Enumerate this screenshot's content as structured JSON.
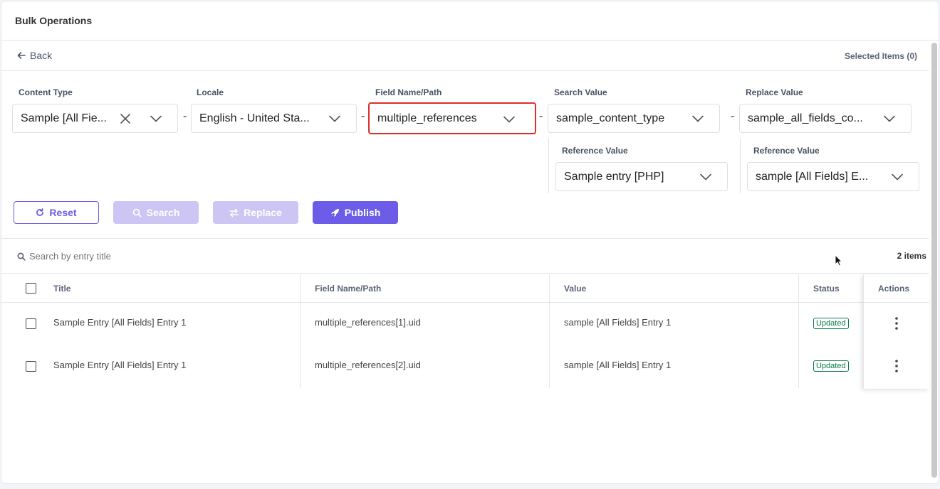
{
  "app": {
    "title": "Bulk Operations"
  },
  "nav": {
    "back_label": "Back",
    "selected_items": "Selected Items (0)"
  },
  "filters": {
    "content_type": {
      "label": "Content Type",
      "value": "Sample [All Fie..."
    },
    "locale": {
      "label": "Locale",
      "value": "English - United Sta..."
    },
    "field_name": {
      "label": "Field Name/Path",
      "value": "multiple_references"
    },
    "search_value": {
      "label": "Search Value",
      "value": "sample_content_type"
    },
    "replace_value": {
      "label": "Replace Value",
      "value": "sample_all_fields_co..."
    },
    "search_reference": {
      "label": "Reference Value",
      "value": "Sample entry [PHP]"
    },
    "replace_reference": {
      "label": "Reference Value",
      "value": "sample [All Fields] E..."
    },
    "separator": "-"
  },
  "buttons": {
    "reset": "Reset",
    "search": "Search",
    "replace": "Replace",
    "publish": "Publish"
  },
  "table_search": {
    "placeholder": "Search by entry title",
    "count": "2 items"
  },
  "table": {
    "columns": {
      "title": "Title",
      "field": "Field Name/Path",
      "value": "Value",
      "status": "Status",
      "actions": "Actions"
    },
    "rows": [
      {
        "title": "Sample Entry [All Fields] Entry 1",
        "field": "multiple_references[1].uid",
        "value": "sample [All Fields] Entry 1",
        "status": "Updated"
      },
      {
        "title": "Sample Entry [All Fields] Entry 1",
        "field": "multiple_references[2].uid",
        "value": "sample [All Fields] Entry 1",
        "status": "Updated"
      }
    ]
  },
  "colors": {
    "accent": "#6c5ce7",
    "accent_disabled": "#cdc6f4",
    "highlight": "#d9302c",
    "status_green": "#0a7a4a"
  }
}
